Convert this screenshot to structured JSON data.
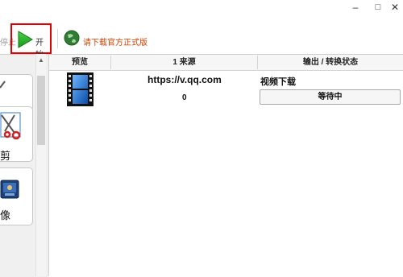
{
  "window": {
    "minimize_glyph": "–",
    "maximize_glyph": "□",
    "close_glyph": "✕"
  },
  "toolbar": {
    "stop_label": "停止",
    "start_label": "开始",
    "download_label": "请下载官方正式版",
    "start_icon": "play-icon",
    "download_icon": "globe-download-icon"
  },
  "sidebar": {
    "items": [
      {
        "label": "",
        "icon": "partial-tool-icon"
      },
      {
        "label": "剪",
        "icon": "scissors-icon"
      },
      {
        "label": "像",
        "icon": "image-icon"
      }
    ]
  },
  "table": {
    "columns": [
      "预览",
      "1 来源",
      "输出 / 转换状态"
    ],
    "rows": [
      {
        "preview_icon": "film-strip-icon",
        "source": "https://v.qq.com",
        "count": "0",
        "status": "视频下载",
        "action": "等待中"
      }
    ]
  },
  "colors": {
    "highlight_border": "#e00000",
    "download_text": "#d04000"
  }
}
